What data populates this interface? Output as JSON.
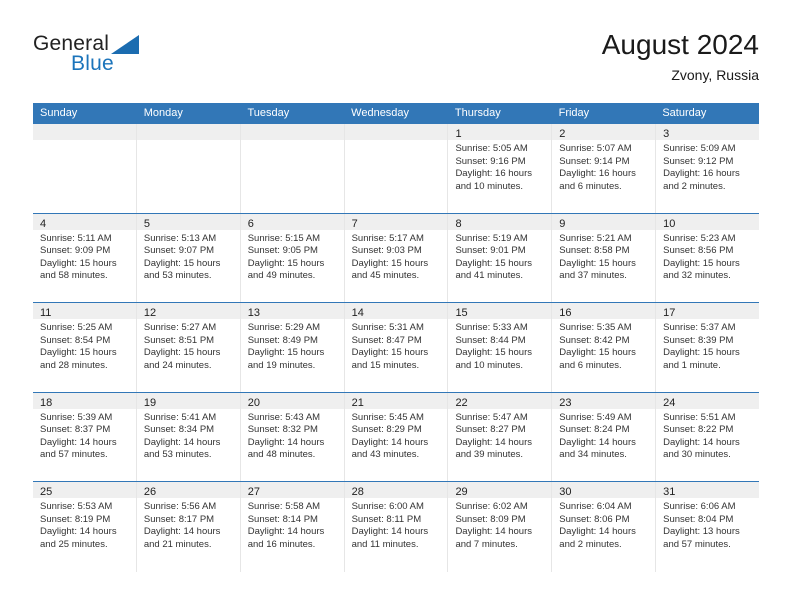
{
  "brand": {
    "name_top": "General",
    "name_bottom": "Blue",
    "accent_color": "#1b6cb0"
  },
  "header": {
    "title": "August 2024",
    "subtitle": "Zvony, Russia"
  },
  "colors": {
    "header_bar": "#3277b7",
    "day_band": "#efefef",
    "row_divider": "#3277b7",
    "cell_divider": "#e6e6e6"
  },
  "weekdays": [
    "Sunday",
    "Monday",
    "Tuesday",
    "Wednesday",
    "Thursday",
    "Friday",
    "Saturday"
  ],
  "weeks": [
    [
      {
        "day": "",
        "empty": true,
        "sunrise": "",
        "sunset": "",
        "daylight_line1": "",
        "daylight_line2": ""
      },
      {
        "day": "",
        "empty": true,
        "sunrise": "",
        "sunset": "",
        "daylight_line1": "",
        "daylight_line2": ""
      },
      {
        "day": "",
        "empty": true,
        "sunrise": "",
        "sunset": "",
        "daylight_line1": "",
        "daylight_line2": ""
      },
      {
        "day": "",
        "empty": true,
        "sunrise": "",
        "sunset": "",
        "daylight_line1": "",
        "daylight_line2": ""
      },
      {
        "day": "1",
        "empty": false,
        "sunrise": "Sunrise: 5:05 AM",
        "sunset": "Sunset: 9:16 PM",
        "daylight_line1": "Daylight: 16 hours",
        "daylight_line2": "and 10 minutes."
      },
      {
        "day": "2",
        "empty": false,
        "sunrise": "Sunrise: 5:07 AM",
        "sunset": "Sunset: 9:14 PM",
        "daylight_line1": "Daylight: 16 hours",
        "daylight_line2": "and 6 minutes."
      },
      {
        "day": "3",
        "empty": false,
        "sunrise": "Sunrise: 5:09 AM",
        "sunset": "Sunset: 9:12 PM",
        "daylight_line1": "Daylight: 16 hours",
        "daylight_line2": "and 2 minutes."
      }
    ],
    [
      {
        "day": "4",
        "empty": false,
        "sunrise": "Sunrise: 5:11 AM",
        "sunset": "Sunset: 9:09 PM",
        "daylight_line1": "Daylight: 15 hours",
        "daylight_line2": "and 58 minutes."
      },
      {
        "day": "5",
        "empty": false,
        "sunrise": "Sunrise: 5:13 AM",
        "sunset": "Sunset: 9:07 PM",
        "daylight_line1": "Daylight: 15 hours",
        "daylight_line2": "and 53 minutes."
      },
      {
        "day": "6",
        "empty": false,
        "sunrise": "Sunrise: 5:15 AM",
        "sunset": "Sunset: 9:05 PM",
        "daylight_line1": "Daylight: 15 hours",
        "daylight_line2": "and 49 minutes."
      },
      {
        "day": "7",
        "empty": false,
        "sunrise": "Sunrise: 5:17 AM",
        "sunset": "Sunset: 9:03 PM",
        "daylight_line1": "Daylight: 15 hours",
        "daylight_line2": "and 45 minutes."
      },
      {
        "day": "8",
        "empty": false,
        "sunrise": "Sunrise: 5:19 AM",
        "sunset": "Sunset: 9:01 PM",
        "daylight_line1": "Daylight: 15 hours",
        "daylight_line2": "and 41 minutes."
      },
      {
        "day": "9",
        "empty": false,
        "sunrise": "Sunrise: 5:21 AM",
        "sunset": "Sunset: 8:58 PM",
        "daylight_line1": "Daylight: 15 hours",
        "daylight_line2": "and 37 minutes."
      },
      {
        "day": "10",
        "empty": false,
        "sunrise": "Sunrise: 5:23 AM",
        "sunset": "Sunset: 8:56 PM",
        "daylight_line1": "Daylight: 15 hours",
        "daylight_line2": "and 32 minutes."
      }
    ],
    [
      {
        "day": "11",
        "empty": false,
        "sunrise": "Sunrise: 5:25 AM",
        "sunset": "Sunset: 8:54 PM",
        "daylight_line1": "Daylight: 15 hours",
        "daylight_line2": "and 28 minutes."
      },
      {
        "day": "12",
        "empty": false,
        "sunrise": "Sunrise: 5:27 AM",
        "sunset": "Sunset: 8:51 PM",
        "daylight_line1": "Daylight: 15 hours",
        "daylight_line2": "and 24 minutes."
      },
      {
        "day": "13",
        "empty": false,
        "sunrise": "Sunrise: 5:29 AM",
        "sunset": "Sunset: 8:49 PM",
        "daylight_line1": "Daylight: 15 hours",
        "daylight_line2": "and 19 minutes."
      },
      {
        "day": "14",
        "empty": false,
        "sunrise": "Sunrise: 5:31 AM",
        "sunset": "Sunset: 8:47 PM",
        "daylight_line1": "Daylight: 15 hours",
        "daylight_line2": "and 15 minutes."
      },
      {
        "day": "15",
        "empty": false,
        "sunrise": "Sunrise: 5:33 AM",
        "sunset": "Sunset: 8:44 PM",
        "daylight_line1": "Daylight: 15 hours",
        "daylight_line2": "and 10 minutes."
      },
      {
        "day": "16",
        "empty": false,
        "sunrise": "Sunrise: 5:35 AM",
        "sunset": "Sunset: 8:42 PM",
        "daylight_line1": "Daylight: 15 hours",
        "daylight_line2": "and 6 minutes."
      },
      {
        "day": "17",
        "empty": false,
        "sunrise": "Sunrise: 5:37 AM",
        "sunset": "Sunset: 8:39 PM",
        "daylight_line1": "Daylight: 15 hours",
        "daylight_line2": "and 1 minute."
      }
    ],
    [
      {
        "day": "18",
        "empty": false,
        "sunrise": "Sunrise: 5:39 AM",
        "sunset": "Sunset: 8:37 PM",
        "daylight_line1": "Daylight: 14 hours",
        "daylight_line2": "and 57 minutes."
      },
      {
        "day": "19",
        "empty": false,
        "sunrise": "Sunrise: 5:41 AM",
        "sunset": "Sunset: 8:34 PM",
        "daylight_line1": "Daylight: 14 hours",
        "daylight_line2": "and 53 minutes."
      },
      {
        "day": "20",
        "empty": false,
        "sunrise": "Sunrise: 5:43 AM",
        "sunset": "Sunset: 8:32 PM",
        "daylight_line1": "Daylight: 14 hours",
        "daylight_line2": "and 48 minutes."
      },
      {
        "day": "21",
        "empty": false,
        "sunrise": "Sunrise: 5:45 AM",
        "sunset": "Sunset: 8:29 PM",
        "daylight_line1": "Daylight: 14 hours",
        "daylight_line2": "and 43 minutes."
      },
      {
        "day": "22",
        "empty": false,
        "sunrise": "Sunrise: 5:47 AM",
        "sunset": "Sunset: 8:27 PM",
        "daylight_line1": "Daylight: 14 hours",
        "daylight_line2": "and 39 minutes."
      },
      {
        "day": "23",
        "empty": false,
        "sunrise": "Sunrise: 5:49 AM",
        "sunset": "Sunset: 8:24 PM",
        "daylight_line1": "Daylight: 14 hours",
        "daylight_line2": "and 34 minutes."
      },
      {
        "day": "24",
        "empty": false,
        "sunrise": "Sunrise: 5:51 AM",
        "sunset": "Sunset: 8:22 PM",
        "daylight_line1": "Daylight: 14 hours",
        "daylight_line2": "and 30 minutes."
      }
    ],
    [
      {
        "day": "25",
        "empty": false,
        "sunrise": "Sunrise: 5:53 AM",
        "sunset": "Sunset: 8:19 PM",
        "daylight_line1": "Daylight: 14 hours",
        "daylight_line2": "and 25 minutes."
      },
      {
        "day": "26",
        "empty": false,
        "sunrise": "Sunrise: 5:56 AM",
        "sunset": "Sunset: 8:17 PM",
        "daylight_line1": "Daylight: 14 hours",
        "daylight_line2": "and 21 minutes."
      },
      {
        "day": "27",
        "empty": false,
        "sunrise": "Sunrise: 5:58 AM",
        "sunset": "Sunset: 8:14 PM",
        "daylight_line1": "Daylight: 14 hours",
        "daylight_line2": "and 16 minutes."
      },
      {
        "day": "28",
        "empty": false,
        "sunrise": "Sunrise: 6:00 AM",
        "sunset": "Sunset: 8:11 PM",
        "daylight_line1": "Daylight: 14 hours",
        "daylight_line2": "and 11 minutes."
      },
      {
        "day": "29",
        "empty": false,
        "sunrise": "Sunrise: 6:02 AM",
        "sunset": "Sunset: 8:09 PM",
        "daylight_line1": "Daylight: 14 hours",
        "daylight_line2": "and 7 minutes."
      },
      {
        "day": "30",
        "empty": false,
        "sunrise": "Sunrise: 6:04 AM",
        "sunset": "Sunset: 8:06 PM",
        "daylight_line1": "Daylight: 14 hours",
        "daylight_line2": "and 2 minutes."
      },
      {
        "day": "31",
        "empty": false,
        "sunrise": "Sunrise: 6:06 AM",
        "sunset": "Sunset: 8:04 PM",
        "daylight_line1": "Daylight: 13 hours",
        "daylight_line2": "and 57 minutes."
      }
    ]
  ]
}
